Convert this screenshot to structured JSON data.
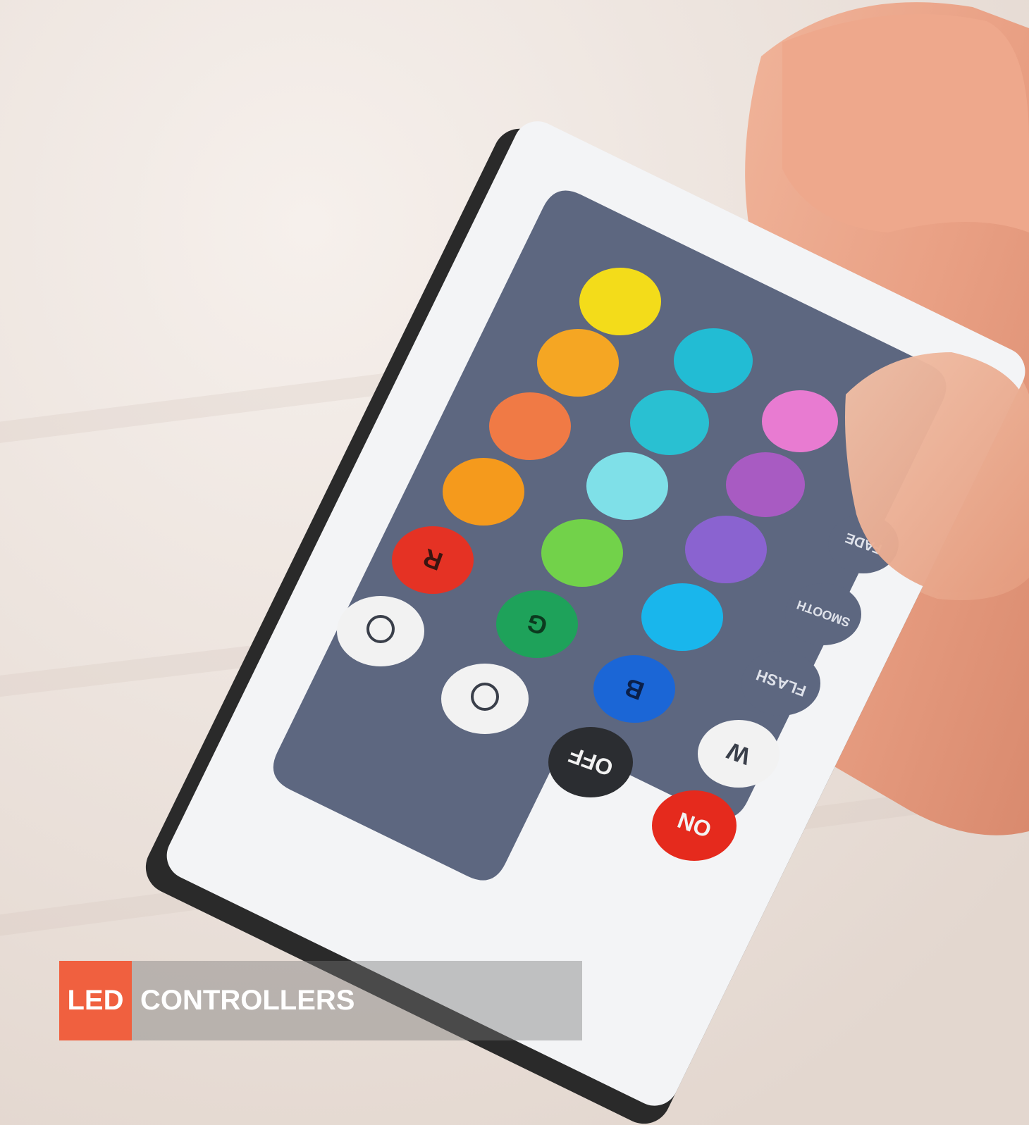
{
  "banner": {
    "tag": "LED",
    "title": "CONTROLLERS",
    "tag_color": "#f0603f"
  },
  "remote": {
    "keys": {
      "r": "R",
      "g": "G",
      "b": "B",
      "w": "W",
      "off": "OFF",
      "on": "ON",
      "flash": "FLASH",
      "smooth": "SMOOTH",
      "fade": "FADE"
    },
    "color_buttons": [
      "#f3dc1a",
      "#f5a623",
      "#f07a45",
      "#f59a1c",
      "#e53224",
      "#22bcd4",
      "#29c0d2",
      "#7fe0e8",
      "#72d24a",
      "#1ea25a",
      "#e87bd1",
      "#a85bc2",
      "#8a63d0",
      "#19b6ec",
      "#1b66d6"
    ]
  }
}
